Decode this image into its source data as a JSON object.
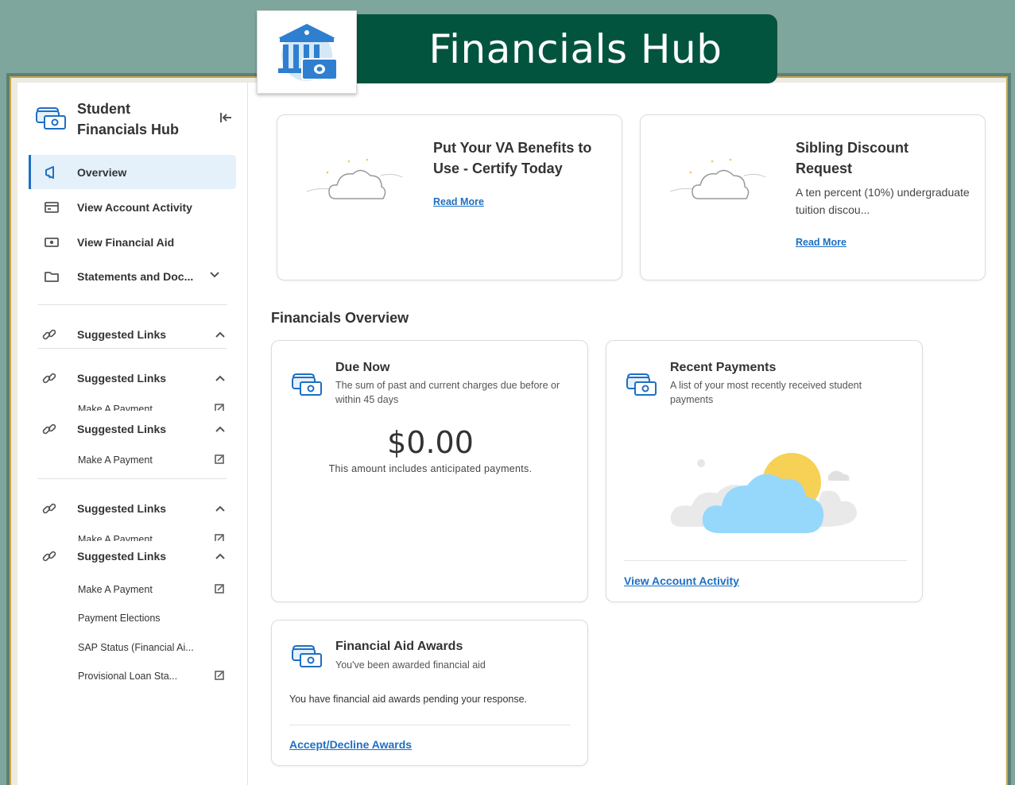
{
  "banner": {
    "title": "Financials Hub",
    "logo_icon": "bank-money-icon"
  },
  "sidebar": {
    "title": "Student Financials Hub",
    "collapse_icon": "collapse-left-icon",
    "nav": [
      {
        "label": "Overview",
        "icon": "megaphone-icon",
        "active": true
      },
      {
        "label": "View Account Activity",
        "icon": "card-icon"
      },
      {
        "label": "View Financial Aid",
        "icon": "cash-icon"
      },
      {
        "label": "Statements and Doc...",
        "icon": "folder-icon",
        "expand": "chevron-down-icon"
      }
    ],
    "suggested": [
      {
        "label": "Suggested Links"
      },
      {
        "label": "Suggested Links",
        "links": [
          "Make A Payment"
        ]
      },
      {
        "label": "Suggested Links",
        "links": [
          "Make A Payment"
        ]
      },
      {
        "label": "Suggested Links",
        "links": [
          "Make A Payment"
        ]
      },
      {
        "label": "Suggested Links",
        "links": [
          "Make A Payment",
          "Payment Elections",
          "SAP Status (Financial Ai...",
          "Provisional Loan Sta..."
        ]
      }
    ]
  },
  "promos": [
    {
      "title": "Put Your VA Benefits to Use - Certify Today",
      "description": "",
      "link": "Read More"
    },
    {
      "title": "Sibling Discount Request",
      "description": "A ten percent (10%) undergraduate tuition discou...",
      "link": "Read More"
    }
  ],
  "overview": {
    "title": "Financials Overview",
    "due_now": {
      "title": "Due Now",
      "subtitle": "The sum of past and current charges due before or within 45 days",
      "amount": "$0.00",
      "note": "This amount includes anticipated payments."
    },
    "recent_payments": {
      "title": "Recent Payments",
      "subtitle": "A list of your most recently received student payments",
      "link": "View Account Activity"
    },
    "aid_awards": {
      "title": "Financial Aid Awards",
      "subtitle": "You've been awarded financial aid",
      "body": "You have financial aid awards pending your response.",
      "link": "Accept/Decline Awards"
    }
  },
  "colors": {
    "accent": "#1e6fc3",
    "banner": "#03543f",
    "background": "#7fa69c",
    "frame_border": "#c9a64a"
  }
}
